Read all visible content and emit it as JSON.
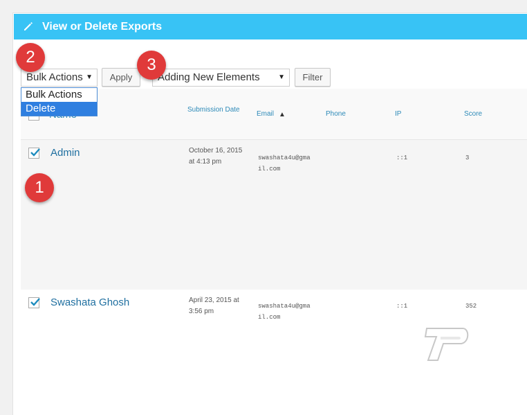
{
  "header": {
    "title": "View or Delete Exports",
    "icon": "pencil-icon",
    "color": "#38c3f5"
  },
  "toolbar": {
    "bulk_actions_selected": "Bulk Actions",
    "apply_label": "Apply",
    "form_selected": "Adding New Elements",
    "filter_label": "Filter"
  },
  "bulk_dropdown": {
    "options": [
      "Bulk Actions",
      "Delete"
    ],
    "highlighted": "Delete"
  },
  "table": {
    "columns": {
      "name": "Name",
      "submission_date": "Submission Date",
      "email": "Email",
      "phone": "Phone",
      "ip": "IP",
      "score": "Score"
    },
    "rows": [
      {
        "checked": true,
        "name": "Admin",
        "date_line1": "October 16, 2015",
        "date_line2": "at 4:13 pm",
        "email_line1": "swashata4u@gma",
        "email_line2": "il.com",
        "phone": "",
        "ip": "::1",
        "score": "3"
      },
      {
        "checked": true,
        "name": "Swashata Ghosh",
        "date_line1": "April 23, 2015 at",
        "date_line2": "3:56 pm",
        "email_line1": "swashata4u@gma",
        "email_line2": "il.com",
        "phone": "",
        "ip": "::1",
        "score": "352"
      }
    ]
  },
  "annotations": {
    "badge_1": "1",
    "badge_2": "2",
    "badge_3": "3",
    "badge_color": "#e03a3a"
  }
}
